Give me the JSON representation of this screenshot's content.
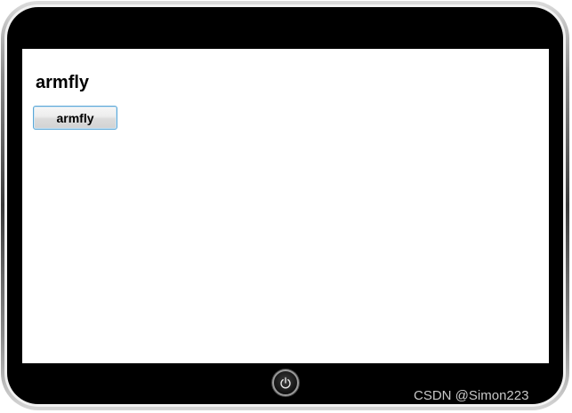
{
  "app": {
    "title": "armfly",
    "button_label": "armfly"
  },
  "device": {
    "home_button_icon": "power-icon"
  },
  "watermark": {
    "text": "CSDN @Simon223"
  },
  "colors": {
    "bezel": "#000000",
    "screen": "#ffffff",
    "button_border": "#5aa6d6"
  }
}
